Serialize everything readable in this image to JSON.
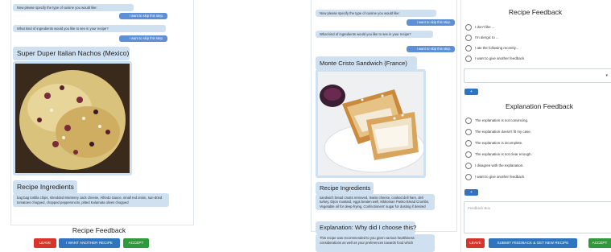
{
  "left": {
    "msgs": {
      "q_cuisine": "Now please specify the type of cuisine you would like:",
      "skip1": "I want to skip this step.",
      "q_ingredients": "What kind of ingredients would you like to see in your recipe?",
      "skip2": "I want to skip this step."
    },
    "recipe_title": "Super Duper Italian Nachos (Mexico)",
    "ingredients_header": "Recipe Ingredients",
    "ingredients_text": "bag bag tortilla chips, shredded Monterey Jack cheese, Alfredo Sauce, small red onion, sun-dried tomatoes chopped, chopped pepperoncini, pitted Kalamata olives chopped",
    "feedback_title": "Recipe Feedback",
    "buttons": {
      "leave": "LEAVE",
      "another": "I WANT ANOTHER RECIPE",
      "accept": "ACCEPT"
    }
  },
  "right": {
    "msgs": {
      "q_cuisine": "Now please specify the type of cuisine you would like:",
      "skip1": "I want to skip this step.",
      "q_ingredients": "What kind of ingredients would you like to see in your recipe?",
      "skip2": "I want to skip this step."
    },
    "recipe_title": "Monte Cristo Sandwich (France)",
    "ingredients_header": "Recipe Ingredients",
    "ingredients_text": "sandwich bread crusts removed, Swiss cheese, cooked deli ham, deli turkey, Dijon mustard, eggs beaten well, Kikkoman Panko Bread Crumbs, Vegetable oil for deep-frying, Confectioners' sugar for dusting if desired",
    "explanation_header": "Explanation: Why did I choose this?",
    "explanation_text": "This recipe was recommended to you given various healthiness considerations as well as your preferences towards food which",
    "recipe_feedback": {
      "title": "Recipe Feedback",
      "options": [
        "I don't like ...",
        "I'm alergic to ...",
        "I ate the following recently...",
        "I want to give another feedback"
      ],
      "add_label": "+"
    },
    "explanation_feedback": {
      "title": "Explanation Feedback",
      "options": [
        "The explanation is not convincing.",
        "The explanation doesn't fit my case.",
        "The explanation is incomplete.",
        "The explanation is not clear enough.",
        "I disagree with the explanation.",
        "I want to give another feedback"
      ],
      "add_label": "+"
    },
    "feedback_box_placeholder": "Feedback Box",
    "buttons": {
      "leave": "LEAVE",
      "submit": "SUBMIT FEEDBACK & GET NEW RECIPE",
      "accept": "ACCEPT"
    }
  }
}
